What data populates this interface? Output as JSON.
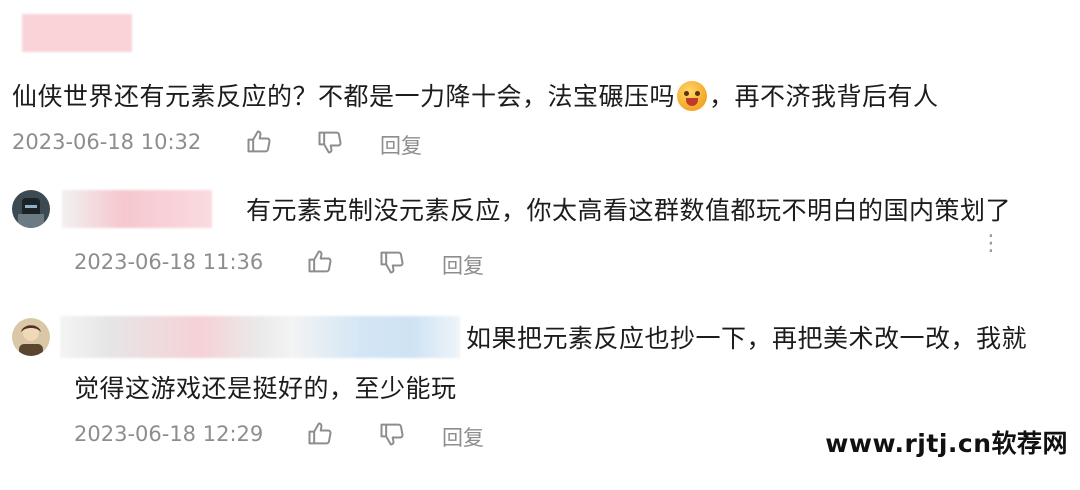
{
  "comments": [
    {
      "text_before_emoji": "仙侠世界还有元素反应的？不都是一力降十会，法宝碾压吗",
      "emoji": "cool-face-emoji",
      "text_after_emoji": "，再不济我背后有人",
      "timestamp": "2023-06-18 10:32",
      "reply_label": "回复"
    },
    {
      "text": "有元素克制没元素反应，你太高看这群数值都玩不明白的国内策划了",
      "timestamp": "2023-06-18 11:36",
      "reply_label": "回复"
    },
    {
      "text_line1": "如果把元素反应也抄一下，再把美术改一改，我就",
      "text_line2": "觉得这游戏还是挺好的，至少能玩",
      "timestamp": "2023-06-18 12:29",
      "reply_label": "回复"
    }
  ],
  "watermark": "www.rjtj.cn软荐网",
  "colors": {
    "meta_gray": "#8d8d8d",
    "blur_pink": "#f7c9cf",
    "blur_blue": "#cfe3f4"
  }
}
